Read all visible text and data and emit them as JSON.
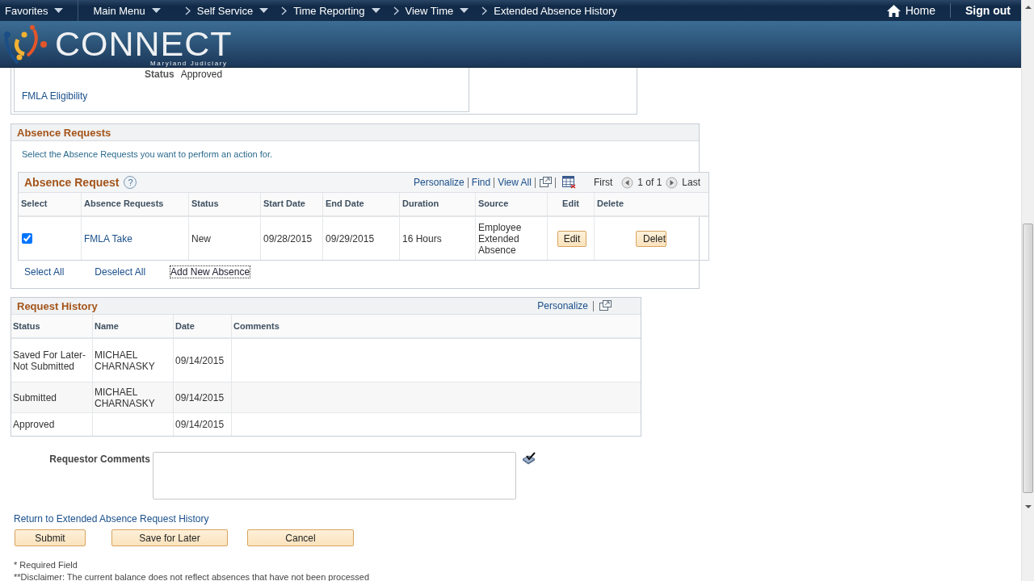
{
  "nav": {
    "items": [
      {
        "label": "Favorites",
        "kind": "menu",
        "dropdown": true
      },
      {
        "label": "Main Menu",
        "kind": "menu",
        "dropdown": true
      },
      {
        "label": "Self Service",
        "kind": "crumb",
        "dropdown": true
      },
      {
        "label": "Time Reporting",
        "kind": "crumb",
        "dropdown": true
      },
      {
        "label": "View Time",
        "kind": "crumb",
        "dropdown": true
      },
      {
        "label": "Extended Absence History",
        "kind": "crumb",
        "dropdown": false
      }
    ],
    "home": "Home",
    "sign_out": "Sign out"
  },
  "brand": {
    "name": "CONNECT",
    "subtitle": "Maryland Judiciary"
  },
  "summary": {
    "status_label": "Status",
    "status_value": "Approved",
    "link": "FMLA Eligibility"
  },
  "absence_requests": {
    "title": "Absence Requests",
    "instruction": "Select the Absence Requests you want to perform an action for.",
    "grid": {
      "title": "Absence Request",
      "help": "?",
      "tools": [
        "Personalize",
        "Find",
        "View All"
      ],
      "first": "First",
      "count": "1 of 1",
      "last": "Last",
      "columns": [
        "Select",
        "Absence Requests",
        "Status",
        "Start Date",
        "End Date",
        "Duration",
        "Source",
        "Edit",
        "Delete"
      ],
      "rows": [
        {
          "selected": true,
          "request": "FMLA Take",
          "status": "New",
          "start_date": "09/28/2015",
          "end_date": "09/29/2015",
          "duration": "16 Hours",
          "source": "Employee Extended Absence",
          "edit": "Edit",
          "delete": "Delet"
        }
      ]
    },
    "links": [
      "Select All",
      "Deselect All",
      "Add New Absence"
    ]
  },
  "request_history": {
    "title": "Request History",
    "personalize": "Personalize",
    "columns": [
      "Status",
      "Name",
      "Date",
      "Comments"
    ],
    "rows": [
      {
        "status": "Saved For Later-Not Submitted",
        "name": "MICHAEL CHARNASKY",
        "date": "09/14/2015"
      },
      {
        "status": "Submitted",
        "name": "MICHAEL CHARNASKY",
        "date": "09/14/2015"
      },
      {
        "status": "Approved",
        "date": "09/14/2015"
      }
    ]
  },
  "comments": {
    "label": "Requestor Comments"
  },
  "return_link": "Return to Extended Absence Request History",
  "buttons": [
    "Submit",
    "Save for Later",
    "Cancel"
  ],
  "required_note": "* Required Field",
  "disclaimer": "**Disclaimer: The current balance does not reflect absences that have not been processed"
}
